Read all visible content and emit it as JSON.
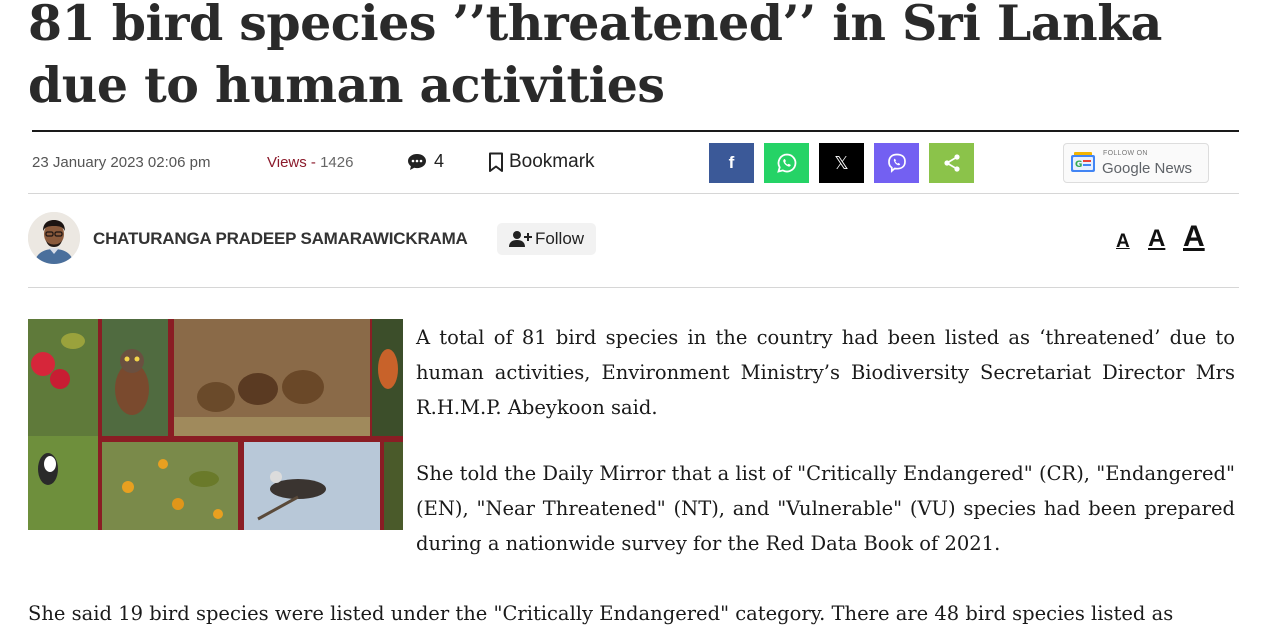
{
  "article": {
    "headline": "81 bird species ’’threatened’’ in Sri Lanka due to human activities",
    "date": "23 January 2023 02:06 pm",
    "views_label": "Views - ",
    "views_count": "1426",
    "comments_count": "4",
    "bookmark_label": "Bookmark"
  },
  "share": {
    "facebook": "f",
    "x": "𝕏",
    "colors": {
      "facebook": "#3b5998",
      "whatsapp": "#25d366",
      "x": "#000000",
      "viber": "#7360f2",
      "share": "#8bc34a"
    }
  },
  "google_news": {
    "small_label": "FOLLOW ON",
    "label": "Google News"
  },
  "author": {
    "name": "CHATURANGA PRADEEP SAMARAWICKRAMA",
    "follow_label": "Follow"
  },
  "font_size_controls": [
    "A",
    "A",
    "A"
  ],
  "body": {
    "p1": "A total of 81 bird species in the country had been listed as ‘threatened’ due to human activities, Environment Ministry’s Biodiversity Secretariat Director Mrs R.H.M.P. Abeykoon said.",
    "p2": "She told the Daily Mirror that a list of \"Critically Endangered\" (CR), \"Endangered\" (EN), \"Near Threatened\" (NT), and \"Vulnerable\" (VU) species had been prepared during a nationwide survey for the Red Data Book of 2021.",
    "p3": "She said 19 bird species were listed under the \"Critically Endangered\" category. There are 48 bird species listed as"
  }
}
